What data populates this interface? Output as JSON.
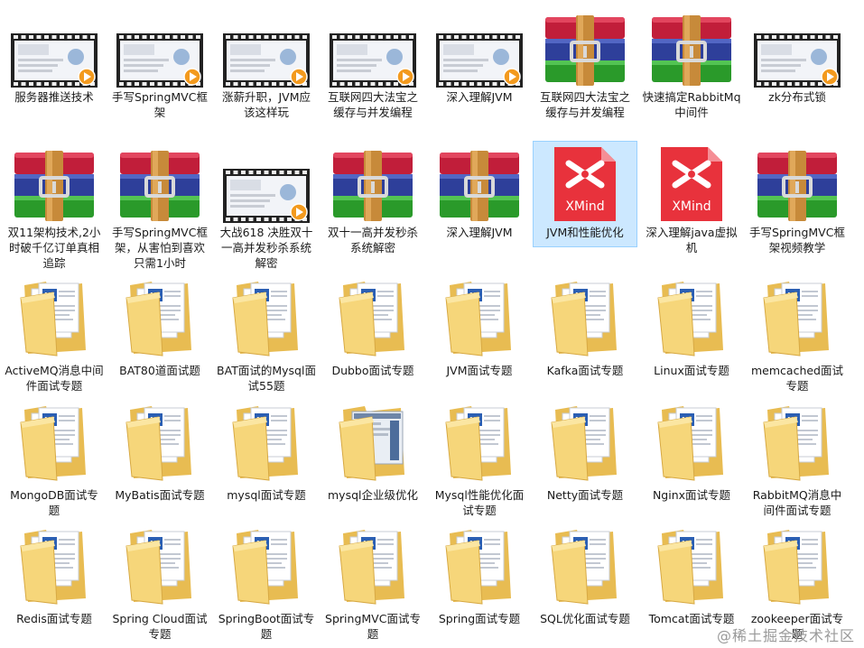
{
  "colors": {
    "selection_bg": "#cce8ff",
    "selection_border": "#99d1ff",
    "folder_front": "#f6d67a",
    "folder_back": "#e8bc52",
    "xmind_red": "#e8323c",
    "video_play": "#f39a1e"
  },
  "items": [
    {
      "label": "服务器推送技术",
      "icon": "video-file-icon",
      "selected": false
    },
    {
      "label": "手写SpringMVC框架",
      "icon": "video-file-icon",
      "selected": false
    },
    {
      "label": "涨薪升职，JVM应该这样玩",
      "icon": "video-file-icon",
      "selected": false
    },
    {
      "label": "互联网四大法宝之缓存与并发编程",
      "icon": "video-file-icon",
      "selected": false
    },
    {
      "label": "深入理解JVM",
      "icon": "video-file-icon",
      "selected": false
    },
    {
      "label": "互联网四大法宝之缓存与并发编程",
      "icon": "archive-icon",
      "selected": false
    },
    {
      "label": "快速搞定RabbitMq中间件",
      "icon": "archive-icon",
      "selected": false
    },
    {
      "label": "zk分布式锁",
      "icon": "video-file-icon",
      "selected": false
    },
    {
      "label": "双11架构技术,2小时破千亿订单真相追踪",
      "icon": "archive-icon",
      "selected": false
    },
    {
      "label": "手写SpringMVC框架，从害怕到喜欢只需1小时",
      "icon": "archive-icon",
      "selected": false
    },
    {
      "label": "大战618 决胜双十一高并发秒杀系统解密",
      "icon": "video-file-icon",
      "selected": false
    },
    {
      "label": "双十一高并发秒杀系统解密",
      "icon": "archive-icon",
      "selected": false
    },
    {
      "label": "深入理解JVM",
      "icon": "archive-icon",
      "selected": false
    },
    {
      "label": "JVM和性能优化",
      "icon": "xmind-icon",
      "selected": true
    },
    {
      "label": "深入理解java虚拟机",
      "icon": "xmind-icon",
      "selected": false
    },
    {
      "label": "手写SpringMVC框架视频教学",
      "icon": "archive-icon",
      "selected": false
    },
    {
      "label": "ActiveMQ消息中间件面试专题",
      "icon": "folder-icon",
      "selected": false
    },
    {
      "label": "BAT80道面试题",
      "icon": "folder-icon",
      "selected": false
    },
    {
      "label": "BAT面试的Mysql面试55题",
      "icon": "folder-icon",
      "selected": false
    },
    {
      "label": "Dubbo面试专题",
      "icon": "folder-icon",
      "selected": false
    },
    {
      "label": "JVM面试专题",
      "icon": "folder-icon",
      "selected": false
    },
    {
      "label": "Kafka面试专题",
      "icon": "folder-icon",
      "selected": false
    },
    {
      "label": "Linux面试专题",
      "icon": "folder-icon",
      "selected": false
    },
    {
      "label": "memcached面试专题",
      "icon": "folder-icon",
      "selected": false
    },
    {
      "label": "MongoDB面试专题",
      "icon": "folder-icon",
      "selected": false
    },
    {
      "label": "MyBatis面试专题",
      "icon": "folder-icon",
      "selected": false
    },
    {
      "label": "mysql面试专题",
      "icon": "folder-icon",
      "selected": false
    },
    {
      "label": "mysql企业级优化",
      "icon": "folder-screenshot-icon",
      "selected": false
    },
    {
      "label": "Mysql性能优化面试专题",
      "icon": "folder-icon",
      "selected": false
    },
    {
      "label": "Netty面试专题",
      "icon": "folder-icon",
      "selected": false
    },
    {
      "label": "Nginx面试专题",
      "icon": "folder-icon",
      "selected": false
    },
    {
      "label": "RabbitMQ消息中间件面试专题",
      "icon": "folder-icon",
      "selected": false
    },
    {
      "label": "Redis面试专题",
      "icon": "folder-icon",
      "selected": false
    },
    {
      "label": "Spring Cloud面试专题",
      "icon": "folder-icon",
      "selected": false
    },
    {
      "label": "SpringBoot面试专题",
      "icon": "folder-icon",
      "selected": false
    },
    {
      "label": "SpringMVC面试专题",
      "icon": "folder-icon",
      "selected": false
    },
    {
      "label": "Spring面试专题",
      "icon": "folder-icon",
      "selected": false
    },
    {
      "label": "SQL优化面试专题",
      "icon": "folder-icon",
      "selected": false
    },
    {
      "label": "Tomcat面试专题",
      "icon": "folder-icon",
      "selected": false
    },
    {
      "label": "zookeeper面试专题",
      "icon": "folder-icon",
      "selected": false
    }
  ],
  "watermark": "@稀土掘金技术社区",
  "xmind_text": "XMind"
}
